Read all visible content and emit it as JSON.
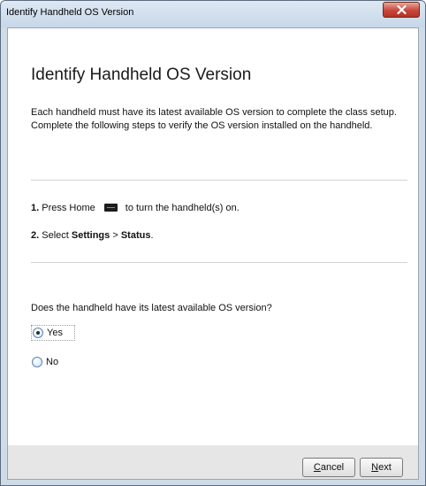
{
  "window": {
    "title": "Identify Handheld OS Version"
  },
  "content": {
    "heading": "Identify Handheld OS Version",
    "description": "Each handheld must have its latest available OS version to complete the class setup. Complete the following steps to verify the OS version installed on the handheld.",
    "step1": {
      "number": "1.",
      "text_before": " Press Home",
      "key_icon": "home-key-icon",
      "text_after": "to turn the handheld(s) on."
    },
    "step2": {
      "number": "2.",
      "text_before": " Select ",
      "bold1": "Settings",
      "separator": " > ",
      "bold2": "Status",
      "end": "."
    },
    "question": "Does the handheld have its latest available OS version?",
    "options": [
      {
        "label": "Yes",
        "selected": true
      },
      {
        "label": "No",
        "selected": false
      }
    ]
  },
  "footer": {
    "cancel_mnemonic": "C",
    "cancel_rest": "ancel",
    "next_mnemonic": "N",
    "next_rest": "ext"
  },
  "colors": {
    "close_button": "#c8473a",
    "radio_border": "#5f86b2"
  }
}
